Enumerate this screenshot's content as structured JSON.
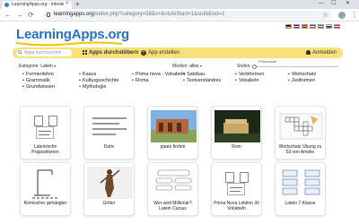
{
  "browser": {
    "tab_title": "LearningApps.org - interaktive u...",
    "tab_close": "×",
    "new_tab": "+",
    "minimize": "—",
    "maximize": "☐",
    "close": "✕",
    "back": "←",
    "forward": "→",
    "reload": "⟳",
    "url_host": "learningapps.org",
    "url_path": "/index.php?category=58&s=&stufeStart=1&stufeEnd=1",
    "bookmark": "☆",
    "menu": "⋮"
  },
  "site": {
    "logo_text": "LearningApps.org",
    "flag_colors": [
      [
        "#000000",
        "#dd0000",
        "#ffce00"
      ],
      [
        "#012169",
        "#ffffff",
        "#c8102e"
      ],
      [
        "#aa151b",
        "#f1bf00",
        "#aa151b"
      ],
      [
        "#0055a4",
        "#ffffff",
        "#ef4135"
      ],
      [
        "#009246",
        "#ffffff",
        "#ce2b37"
      ],
      [
        "#ffffff",
        "#0039a6",
        "#d52b1e"
      ],
      [
        "#dc143c",
        "#ffffff",
        "#dc143c"
      ]
    ]
  },
  "toolbar": {
    "search_placeholder": "Apps durchsuchen",
    "browse_label": "Apps durchstöbern",
    "create_label": "App erstellen",
    "login_label": "Anmelden"
  },
  "filters": {
    "category_label": "Kategorie:",
    "category_value": "Latein",
    "media_label": "Medien:",
    "media_value": "alles",
    "level_label": "Stufen:",
    "level_caption": "Primarstufe",
    "level_fraction": 0.0
  },
  "categories": [
    [
      "Formenlehre",
      "Grammatik",
      "Grundwissen"
    ],
    [
      "Kasus",
      "Kulturgeschichte",
      "Mythologie"
    ],
    [
      "Prima nova - Vokabeln",
      "Roma"
    ],
    [
      "Satzbau",
      "Textverständnis"
    ],
    [
      "Verbformen",
      "Vokabeln"
    ],
    [
      "Wortschatz",
      "Zeitformen"
    ]
  ],
  "apps": [
    {
      "label": "Lateinische Präpositionen"
    },
    {
      "label": "Dativ"
    },
    {
      "label": "paare finden"
    },
    {
      "label": "Rom"
    },
    {
      "label": "Wortschatz Übung zu 53 von Amelie"
    },
    {
      "label": "Römischer gehängter"
    },
    {
      "label": "Götter"
    },
    {
      "label": "Wer wird Millionär? Latein Cursus"
    },
    {
      "label": "Prima Nova Lektion 30 Vokabeln"
    },
    {
      "label": "Latein 7.Klasse"
    }
  ],
  "icons": {
    "search": "search-icon",
    "browse": "grid-icon",
    "create": "plus-icon",
    "login": "user-icon"
  }
}
